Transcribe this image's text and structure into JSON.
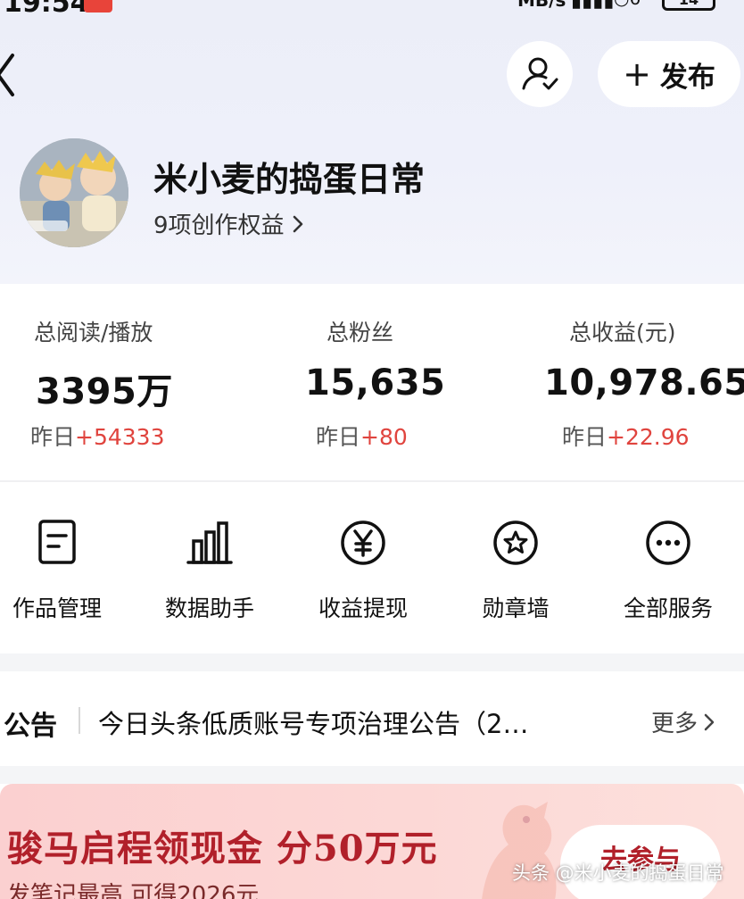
{
  "status_bar": {
    "time": "19:54",
    "network_speed": "MB/s",
    "battery": "14"
  },
  "header": {
    "publish_label": "发布"
  },
  "profile": {
    "name": "米小麦的捣蛋日常",
    "rights_label": "9项创作权益"
  },
  "stats": [
    {
      "label": "总阅读/播放",
      "value": "3395万",
      "delta_prefix": "昨日",
      "delta": "+54333"
    },
    {
      "label": "总粉丝",
      "value": "15,635",
      "delta_prefix": "昨日",
      "delta": "+80"
    },
    {
      "label": "总收益(元)",
      "value": "10,978.65",
      "delta_prefix": "昨日",
      "delta": "+22.96"
    }
  ],
  "services": [
    {
      "label": "作品管理",
      "icon": "document-icon"
    },
    {
      "label": "数据助手",
      "icon": "bar-chart-icon"
    },
    {
      "label": "收益提现",
      "icon": "yen-icon"
    },
    {
      "label": "勋章墙",
      "icon": "star-medal-icon"
    },
    {
      "label": "全部服务",
      "icon": "more-icon"
    }
  ],
  "notice": {
    "title": "公告",
    "text": "今日头条低质账号专项治理公告（2…",
    "more_label": "更多"
  },
  "banner": {
    "title": "骏马启程领现金 分50万元",
    "subtitle": "发笔记最高 可得2026元",
    "cta": "去参与"
  },
  "watermark": "头条 @米小麦的捣蛋日常",
  "colors": {
    "accent_red": "#e0443e",
    "banner_red": "#b1202a",
    "header_bg": "#eceef8"
  }
}
